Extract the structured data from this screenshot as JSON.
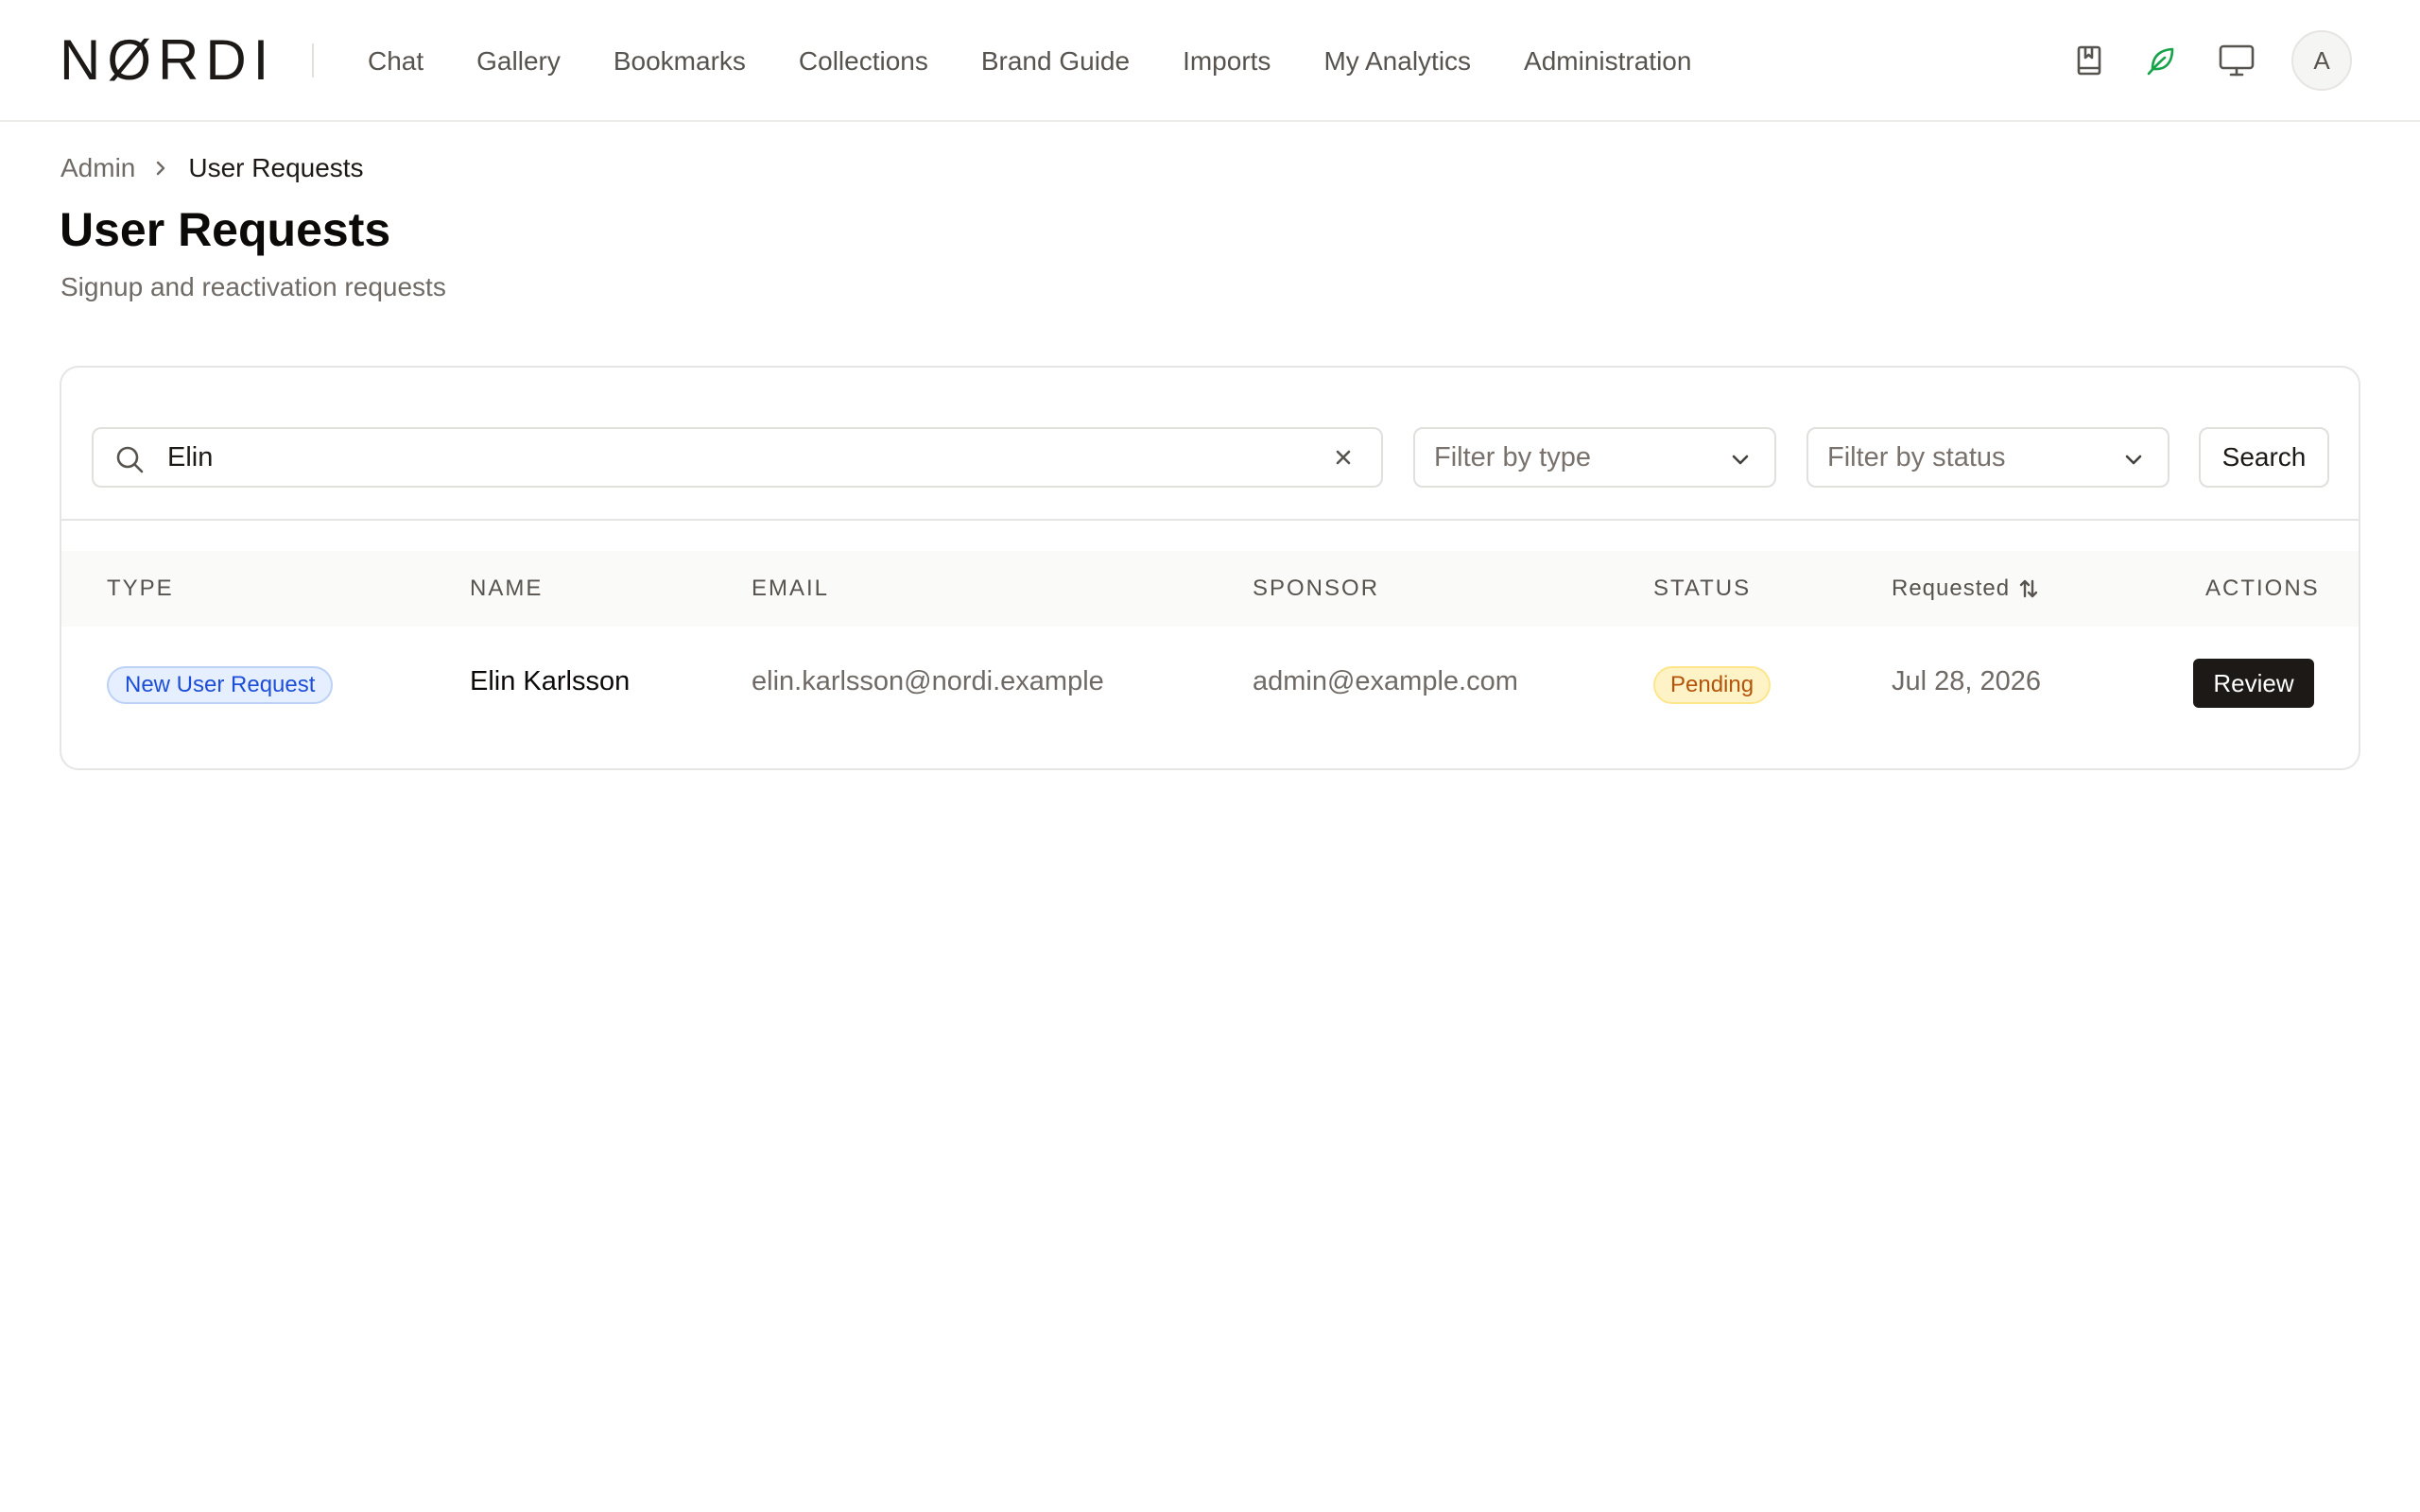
{
  "app": {
    "logo": "NØRDI"
  },
  "nav": {
    "items": [
      {
        "label": "Chat"
      },
      {
        "label": "Gallery"
      },
      {
        "label": "Bookmarks"
      },
      {
        "label": "Collections"
      },
      {
        "label": "Brand Guide"
      },
      {
        "label": "Imports"
      },
      {
        "label": "My Analytics"
      },
      {
        "label": "Administration"
      }
    ],
    "icons": [
      "bookmark-book-icon",
      "leaf-icon",
      "monitor-icon"
    ],
    "accent_color": "#16a34a",
    "avatar_initial": "A"
  },
  "breadcrumb": {
    "parent": "Admin",
    "current": "User Requests"
  },
  "page": {
    "title": "User Requests",
    "subtitle": "Signup and reactivation requests"
  },
  "filters": {
    "search_value": "Elin",
    "type_placeholder": "Filter by type",
    "status_placeholder": "Filter by status",
    "search_button": "Search"
  },
  "table": {
    "columns": {
      "type": "TYPE",
      "name": "NAME",
      "email": "EMAIL",
      "sponsor": "SPONSOR",
      "status": "STATUS",
      "requested": "Requested",
      "actions": "ACTIONS"
    },
    "rows": [
      {
        "type": "New User Request",
        "name": "Elin Karlsson",
        "email": "elin.karlsson@nordi.example",
        "sponsor": "admin@example.com",
        "status": "Pending",
        "requested": "Jul 28, 2026",
        "action": "Review"
      }
    ]
  }
}
